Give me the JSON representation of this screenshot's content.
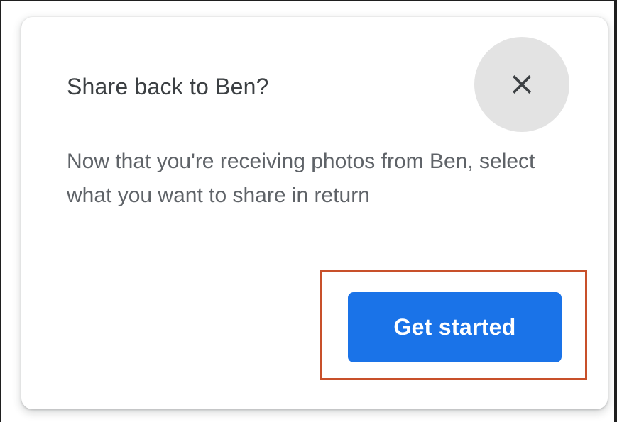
{
  "dialog": {
    "title": "Share back to Ben?",
    "message": "Now that you're receiving photos from Ben, select what you want to share in return",
    "close_icon": "close-icon",
    "primary_button_label": "Get started"
  },
  "colors": {
    "title_text": "#3c4043",
    "body_text": "#5f6368",
    "primary_button_bg": "#1a73e8",
    "primary_button_text": "#ffffff",
    "close_button_bg": "#e3e3e3",
    "highlight_border": "#c8502a"
  }
}
